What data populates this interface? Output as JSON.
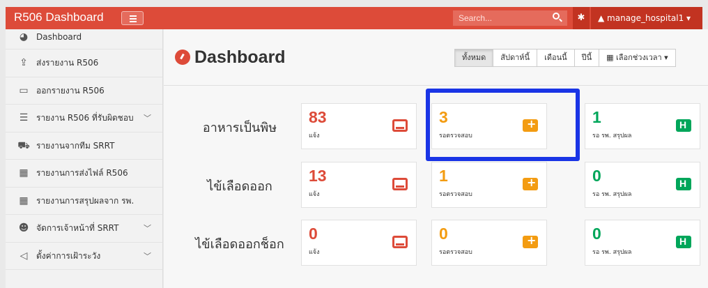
{
  "navbar": {
    "brand": "R506 Dashboard",
    "search_placeholder": "Search...",
    "user": "manage_hospital1 ▾",
    "colors": {
      "navbar": "#dd4b39",
      "highlight": "#1a35e6"
    }
  },
  "sidebar": {
    "items": [
      {
        "label": "Dashboard",
        "icon": "dashboard-icon"
      },
      {
        "label": "ส่งรายงาน R506",
        "icon": "upload-icon"
      },
      {
        "label": "ออกรายงาน R506",
        "icon": "file-icon"
      },
      {
        "label": "รายงาน R506 ที่รับผิดชอบ",
        "icon": "list-icon",
        "chevron": "﹀"
      },
      {
        "label": "รายงานจากทีม SRRT",
        "icon": "ambulance-icon"
      },
      {
        "label": "รายงานการส่งไฟล์ R506",
        "icon": "building-icon"
      },
      {
        "label": "รายงานการสรุปผลจาก รพ.",
        "icon": "building-icon"
      },
      {
        "label": "จัดการเจ้าหน้าที่ SRRT",
        "icon": "users-icon",
        "chevron": "﹀"
      },
      {
        "label": "ตั้งค่าการเฝ้าระวัง",
        "icon": "bullhorn-icon",
        "chevron": "﹀"
      }
    ]
  },
  "main": {
    "title": "Dashboard",
    "ranges": [
      "ทั้งหมด",
      "สัปดาห์นี้",
      "เดือนนี้",
      "ปีนี้",
      "▦ เลือกช่วงเวลา ▾"
    ],
    "active_range": "ทั้งหมด",
    "rows": [
      {
        "label": "อาหารเป็นพิษ",
        "cards": [
          {
            "value": "83",
            "sub": "แจ้ง",
            "tone": "red",
            "icon": "inbox-icon"
          },
          {
            "value": "3",
            "sub": "รอตรวจสอบ",
            "tone": "orange",
            "icon": "ambulance-icon"
          },
          {
            "value": "1",
            "sub": "รอ รพ. สรุปผล",
            "tone": "green",
            "icon": "hospital-icon"
          }
        ]
      },
      {
        "label": "ไข้เลือดออก",
        "cards": [
          {
            "value": "13",
            "sub": "แจ้ง",
            "tone": "red",
            "icon": "inbox-icon"
          },
          {
            "value": "1",
            "sub": "รอตรวจสอบ",
            "tone": "orange",
            "icon": "ambulance-icon"
          },
          {
            "value": "0",
            "sub": "รอ รพ. สรุปผล",
            "tone": "green",
            "icon": "hospital-icon"
          }
        ]
      },
      {
        "label": "ไข้เลือดออกช็อก",
        "cards": [
          {
            "value": "0",
            "sub": "แจ้ง",
            "tone": "red",
            "icon": "inbox-icon"
          },
          {
            "value": "0",
            "sub": "รอตรวจสอบ",
            "tone": "orange",
            "icon": "ambulance-icon"
          },
          {
            "value": "0",
            "sub": "รอ รพ. สรุปผล",
            "tone": "green",
            "icon": "hospital-icon"
          }
        ]
      }
    ]
  }
}
